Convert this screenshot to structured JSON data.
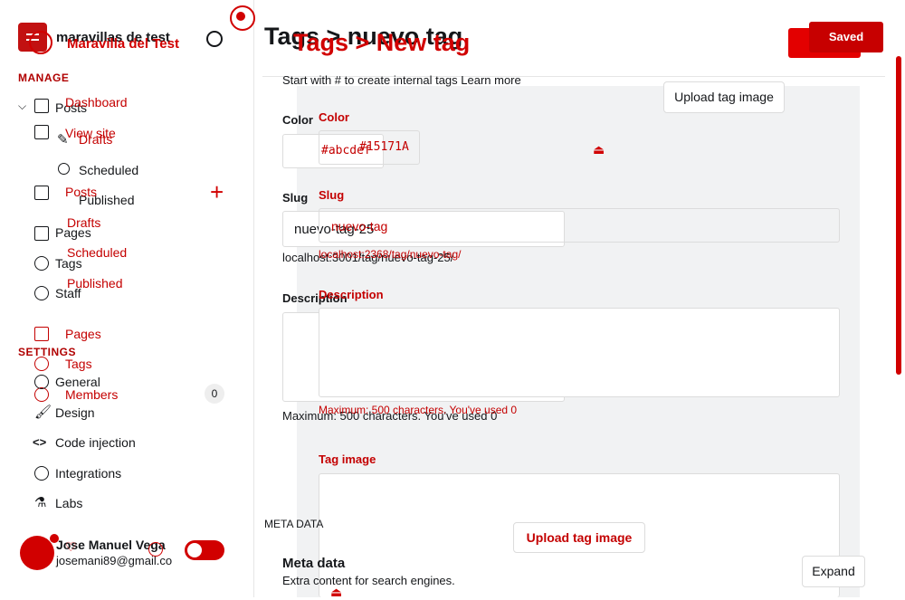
{
  "sidebar": {
    "site_title": "maravillas de test",
    "site_title_overlay": "Maravilla del Test",
    "manage_label": "MANAGE",
    "settings_label": "SETTINGS",
    "nav": {
      "dashboard": "Dashboard",
      "view_site": "View site",
      "posts": "Posts",
      "drafts": "Drafts",
      "scheduled": "Scheduled",
      "published": "Published",
      "pages": "Pages",
      "tags": "Tags",
      "staff": "Staff",
      "members": "Members",
      "members_count": "0",
      "general": "General",
      "design": "Design",
      "code_injection": "Code injection",
      "integrations": "Integrations",
      "labs": "Labs"
    },
    "overlay_nav": {
      "posts": "Posts",
      "drafts": "Drafts",
      "scheduled": "Scheduled",
      "published": "Published",
      "pages": "Pages",
      "tags": "Tags",
      "staff": "Staff"
    },
    "user": {
      "name": "Jose Manuel Vega",
      "email": "josemani89@gmail.co"
    }
  },
  "header": {
    "breadcrumb_a": "Tags  >  nuevo tag",
    "breadcrumb_b": "Tags > New tag",
    "save_label_a": "Save",
    "save_label_b": "Saved"
  },
  "form": {
    "intro": "Start with # to create internal tags Learn more",
    "color_label": "Color",
    "color_placeholder": "#abcdef",
    "color_value": "#15171A",
    "slug_label": "Slug",
    "slug_value": "nuevo-tag-25",
    "slug_value_b": "nuevo-tag",
    "slug_url": "localhost:3001/tag/nuevo-tag-25/",
    "slug_url_b": "localhost:2368/tag/nuevo-tag/",
    "description_label": "Description",
    "description_hint": "Maximum: 500 characters. You've used 0",
    "tag_image_label": "Tag image",
    "upload_image_top": "Upload tag image",
    "upload_image_bottom": "Upload tag image",
    "meta_section_label": "META DATA",
    "meta_title": "Meta data",
    "meta_subtitle": "Extra content for search engines.",
    "expand_label": "Expand"
  },
  "colors": {
    "accent": "#d10000",
    "text": "#15171a",
    "panel": "#f1f2f3"
  }
}
